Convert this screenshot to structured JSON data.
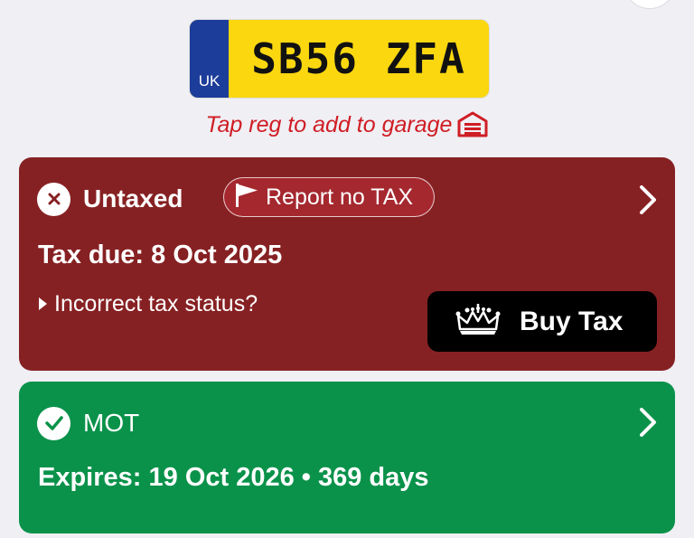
{
  "plate": {
    "country": "UK",
    "registration": "SB56 ZFA"
  },
  "garage_hint": {
    "text": "Tap reg to add to garage",
    "icon": "garage-icon"
  },
  "tax": {
    "status": "Untaxed",
    "status_icon": "cross-circle-icon",
    "report_label": "Report no TAX",
    "report_icon": "flag-icon",
    "due_text": "Tax due: 8 Oct 2025",
    "incorrect_link": "Incorrect tax status?",
    "buy_label": "Buy Tax",
    "buy_icon": "crown-icon",
    "background": "#862123"
  },
  "mot": {
    "title": "MOT",
    "status_icon": "check-circle-icon",
    "expires_text": "Expires: 19 Oct 2026 • 369 days",
    "background": "#0a924a"
  },
  "colors": {
    "plate_yellow": "#fbd70f",
    "plate_blue": "#1d3d9a",
    "hint_red": "#d01d24",
    "page_background": "#efeff4"
  }
}
